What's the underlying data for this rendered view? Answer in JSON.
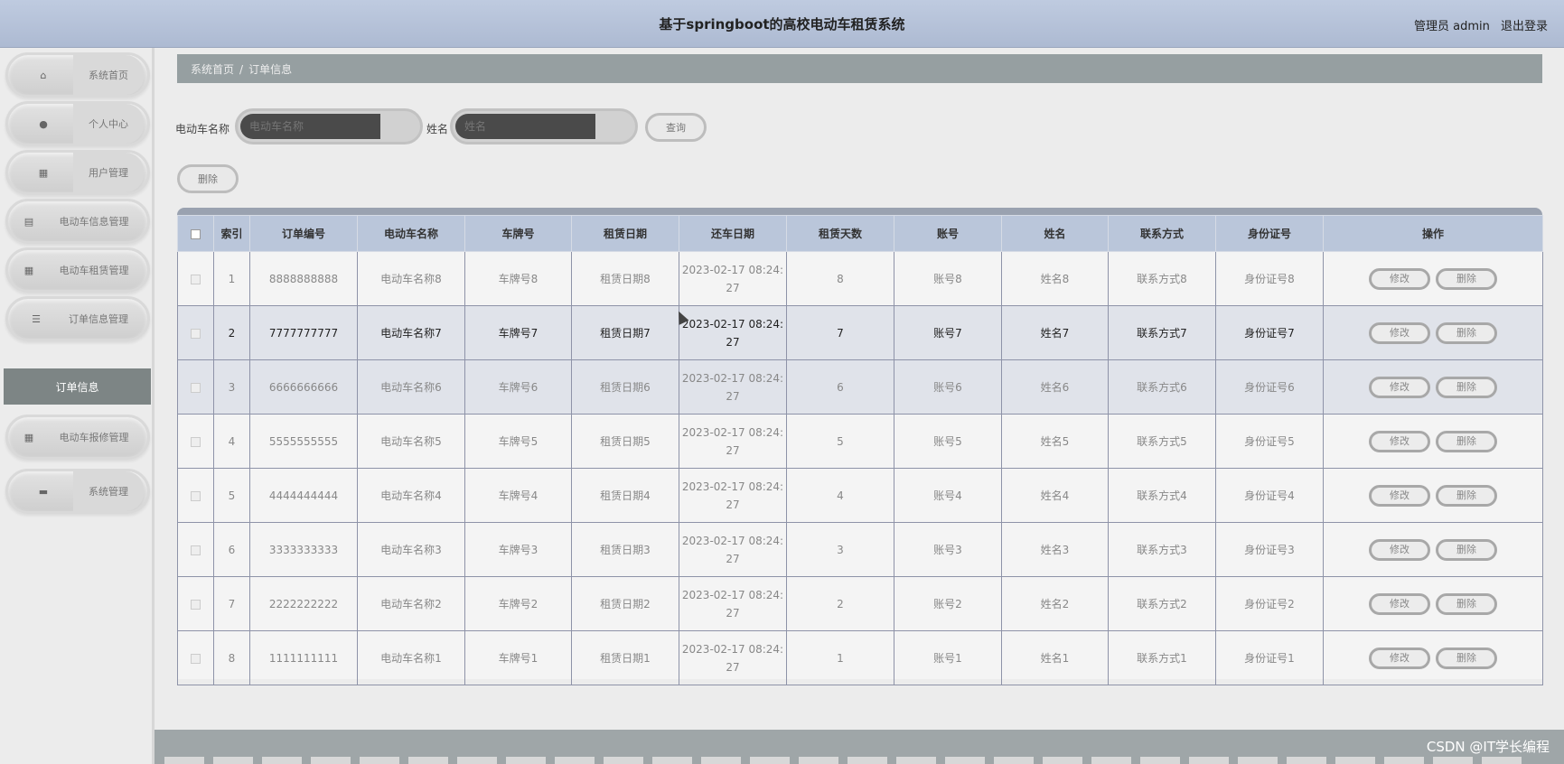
{
  "header": {
    "title": "基于springboot的高校电动车租赁系统",
    "user": "管理员 admin",
    "logout": "退出登录"
  },
  "sidebar": {
    "items": [
      {
        "label": "系统首页",
        "icon": "home-icon",
        "glyph": "⌂"
      },
      {
        "label": "个人中心",
        "icon": "user-icon",
        "glyph": "●"
      },
      {
        "label": "用户管理",
        "icon": "grid-icon",
        "glyph": "▦"
      },
      {
        "label": "电动车信息管理",
        "icon": "doc-icon",
        "glyph": "▤"
      },
      {
        "label": "电动车租赁管理",
        "icon": "grid-icon",
        "glyph": "▦"
      },
      {
        "label": "订单信息管理",
        "icon": "sliders-icon",
        "glyph": "☰"
      },
      {
        "label": "电动车报修管理",
        "icon": "grid-icon",
        "glyph": "▦"
      },
      {
        "label": "系统管理",
        "icon": "chat-icon",
        "glyph": "▬"
      }
    ],
    "active_sub": "订单信息"
  },
  "breadcrumb": {
    "home": "系统首页",
    "sep": "/",
    "current": "订单信息"
  },
  "search": {
    "name_label": "电动车名称",
    "name_placeholder": "电动车名称",
    "person_label": "姓名",
    "person_placeholder": "姓名",
    "query_button": "查询",
    "delete_button": "删除"
  },
  "table": {
    "columns": [
      "索引",
      "订单编号",
      "电动车名称",
      "车牌号",
      "租赁日期",
      "还车日期",
      "租赁天数",
      "账号",
      "姓名",
      "联系方式",
      "身份证号",
      "操作"
    ],
    "edit_label": "修改",
    "delete_label": "删除",
    "rows": [
      {
        "index": "1",
        "order": "8888888888",
        "name": "电动车名称8",
        "plate": "车牌号8",
        "rent": "租赁日期8",
        "return_line1": "2023-02-17 08:24:",
        "return_line2": "27",
        "days": "8",
        "account": "账号8",
        "person": "姓名8",
        "contact": "联系方式8",
        "id": "身份证号8"
      },
      {
        "index": "2",
        "order": "7777777777",
        "name": "电动车名称7",
        "plate": "车牌号7",
        "rent": "租赁日期7",
        "return_line1": "2023-02-17 08:24:",
        "return_line2": "27",
        "days": "7",
        "account": "账号7",
        "person": "姓名7",
        "contact": "联系方式7",
        "id": "身份证号7"
      },
      {
        "index": "3",
        "order": "6666666666",
        "name": "电动车名称6",
        "plate": "车牌号6",
        "rent": "租赁日期6",
        "return_line1": "2023-02-17 08:24:",
        "return_line2": "27",
        "days": "6",
        "account": "账号6",
        "person": "姓名6",
        "contact": "联系方式6",
        "id": "身份证号6"
      },
      {
        "index": "4",
        "order": "5555555555",
        "name": "电动车名称5",
        "plate": "车牌号5",
        "rent": "租赁日期5",
        "return_line1": "2023-02-17 08:24:",
        "return_line2": "27",
        "days": "5",
        "account": "账号5",
        "person": "姓名5",
        "contact": "联系方式5",
        "id": "身份证号5"
      },
      {
        "index": "5",
        "order": "4444444444",
        "name": "电动车名称4",
        "plate": "车牌号4",
        "rent": "租赁日期4",
        "return_line1": "2023-02-17 08:24:",
        "return_line2": "27",
        "days": "4",
        "account": "账号4",
        "person": "姓名4",
        "contact": "联系方式4",
        "id": "身份证号4"
      },
      {
        "index": "6",
        "order": "3333333333",
        "name": "电动车名称3",
        "plate": "车牌号3",
        "rent": "租赁日期3",
        "return_line1": "2023-02-17 08:24:",
        "return_line2": "27",
        "days": "3",
        "account": "账号3",
        "person": "姓名3",
        "contact": "联系方式3",
        "id": "身份证号3"
      },
      {
        "index": "7",
        "order": "2222222222",
        "name": "电动车名称2",
        "plate": "车牌号2",
        "rent": "租赁日期2",
        "return_line1": "2023-02-17 08:24:",
        "return_line2": "27",
        "days": "2",
        "account": "账号2",
        "person": "姓名2",
        "contact": "联系方式2",
        "id": "身份证号2"
      },
      {
        "index": "8",
        "order": "1111111111",
        "name": "电动车名称1",
        "plate": "车牌号1",
        "rent": "租赁日期1",
        "return_line1": "2023-02-17 08:24:",
        "return_line2": "27",
        "days": "1",
        "account": "账号1",
        "person": "姓名1",
        "contact": "联系方式1",
        "id": "身份证号1"
      }
    ]
  },
  "watermark": "CSDN @IT学长编程",
  "colors": {
    "header_bg": "#b4c0d6",
    "table_header_bg": "#bac6da",
    "breadcrumb_bg": "#969fa1",
    "active_submenu_bg": "#7d8585"
  }
}
